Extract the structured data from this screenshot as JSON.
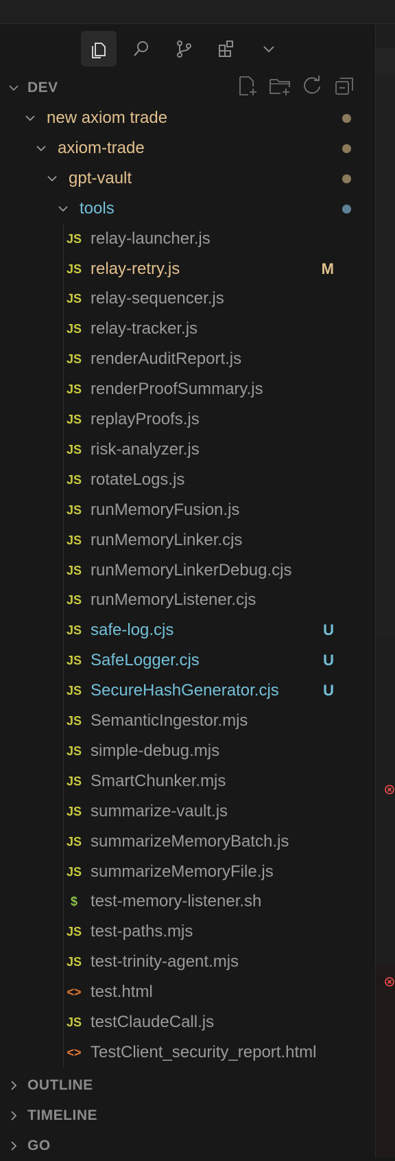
{
  "colors": {
    "folder_modified": "#e2c08d",
    "folder_dot_modified": "#8b7a5a",
    "folder_untracked": "#73c0d9",
    "folder_dot_untracked": "#5f8296",
    "file_default": "#9a9a9a",
    "file_modified": "#e2c08d",
    "file_untracked": "#73c0d9",
    "js_icon": "#cbcb41",
    "sh_icon": "#8dc149",
    "html_icon": "#e37933",
    "error": "#f14c4c"
  },
  "activity_tabs": [
    {
      "name": "explorer-icon",
      "active": true
    },
    {
      "name": "search-icon",
      "active": false
    },
    {
      "name": "source-control-icon",
      "active": false
    },
    {
      "name": "extensions-icon",
      "active": false
    },
    {
      "name": "more-views-chevron-icon",
      "active": false
    }
  ],
  "explorer": {
    "section_title": "DEV",
    "toolbar": [
      "new-file-icon",
      "new-folder-icon",
      "refresh-icon",
      "collapse-all-icon"
    ],
    "folders": [
      {
        "label": "new axiom trade",
        "status": "modified"
      },
      {
        "label": "axiom-trade",
        "status": "modified"
      },
      {
        "label": "gpt-vault",
        "status": "modified"
      },
      {
        "label": "tools",
        "status": "untracked"
      }
    ],
    "files": [
      {
        "label": "relay-launcher.js",
        "icon": "JS",
        "type": "js",
        "status": "",
        "badge": ""
      },
      {
        "label": "relay-retry.js",
        "icon": "JS",
        "type": "js",
        "status": "modified",
        "badge": "M"
      },
      {
        "label": "relay-sequencer.js",
        "icon": "JS",
        "type": "js",
        "status": "",
        "badge": ""
      },
      {
        "label": "relay-tracker.js",
        "icon": "JS",
        "type": "js",
        "status": "",
        "badge": ""
      },
      {
        "label": "renderAuditReport.js",
        "icon": "JS",
        "type": "js",
        "status": "",
        "badge": ""
      },
      {
        "label": "renderProofSummary.js",
        "icon": "JS",
        "type": "js",
        "status": "",
        "badge": ""
      },
      {
        "label": "replayProofs.js",
        "icon": "JS",
        "type": "js",
        "status": "",
        "badge": ""
      },
      {
        "label": "risk-analyzer.js",
        "icon": "JS",
        "type": "js",
        "status": "",
        "badge": ""
      },
      {
        "label": "rotateLogs.js",
        "icon": "JS",
        "type": "js",
        "status": "",
        "badge": ""
      },
      {
        "label": "runMemoryFusion.js",
        "icon": "JS",
        "type": "js",
        "status": "",
        "badge": ""
      },
      {
        "label": "runMemoryLinker.cjs",
        "icon": "JS",
        "type": "js",
        "status": "",
        "badge": ""
      },
      {
        "label": "runMemoryLinkerDebug.cjs",
        "icon": "JS",
        "type": "js",
        "status": "",
        "badge": ""
      },
      {
        "label": "runMemoryListener.cjs",
        "icon": "JS",
        "type": "js",
        "status": "",
        "badge": ""
      },
      {
        "label": "safe-log.cjs",
        "icon": "JS",
        "type": "js",
        "status": "untracked",
        "badge": "U"
      },
      {
        "label": "SafeLogger.cjs",
        "icon": "JS",
        "type": "js",
        "status": "untracked",
        "badge": "U"
      },
      {
        "label": "SecureHashGenerator.cjs",
        "icon": "JS",
        "type": "js",
        "status": "untracked",
        "badge": "U"
      },
      {
        "label": "SemanticIngestor.mjs",
        "icon": "JS",
        "type": "js",
        "status": "",
        "badge": ""
      },
      {
        "label": "simple-debug.mjs",
        "icon": "JS",
        "type": "js",
        "status": "",
        "badge": ""
      },
      {
        "label": "SmartChunker.mjs",
        "icon": "JS",
        "type": "js",
        "status": "",
        "badge": ""
      },
      {
        "label": "summarize-vault.js",
        "icon": "JS",
        "type": "js",
        "status": "",
        "badge": ""
      },
      {
        "label": "summarizeMemoryBatch.js",
        "icon": "JS",
        "type": "js",
        "status": "",
        "badge": ""
      },
      {
        "label": "summarizeMemoryFile.js",
        "icon": "JS",
        "type": "js",
        "status": "",
        "badge": ""
      },
      {
        "label": "test-memory-listener.sh",
        "icon": "$",
        "type": "sh",
        "status": "",
        "badge": ""
      },
      {
        "label": "test-paths.mjs",
        "icon": "JS",
        "type": "js",
        "status": "",
        "badge": ""
      },
      {
        "label": "test-trinity-agent.mjs",
        "icon": "JS",
        "type": "js",
        "status": "",
        "badge": ""
      },
      {
        "label": "test.html",
        "icon": "<>",
        "type": "html",
        "status": "",
        "badge": ""
      },
      {
        "label": "testClaudeCall.js",
        "icon": "JS",
        "type": "js",
        "status": "",
        "badge": ""
      },
      {
        "label": "TestClient_security_report.html",
        "icon": "<>",
        "type": "html",
        "status": "",
        "badge": ""
      }
    ]
  },
  "collapsed_sections": [
    "OUTLINE",
    "TIMELINE",
    "GO"
  ]
}
